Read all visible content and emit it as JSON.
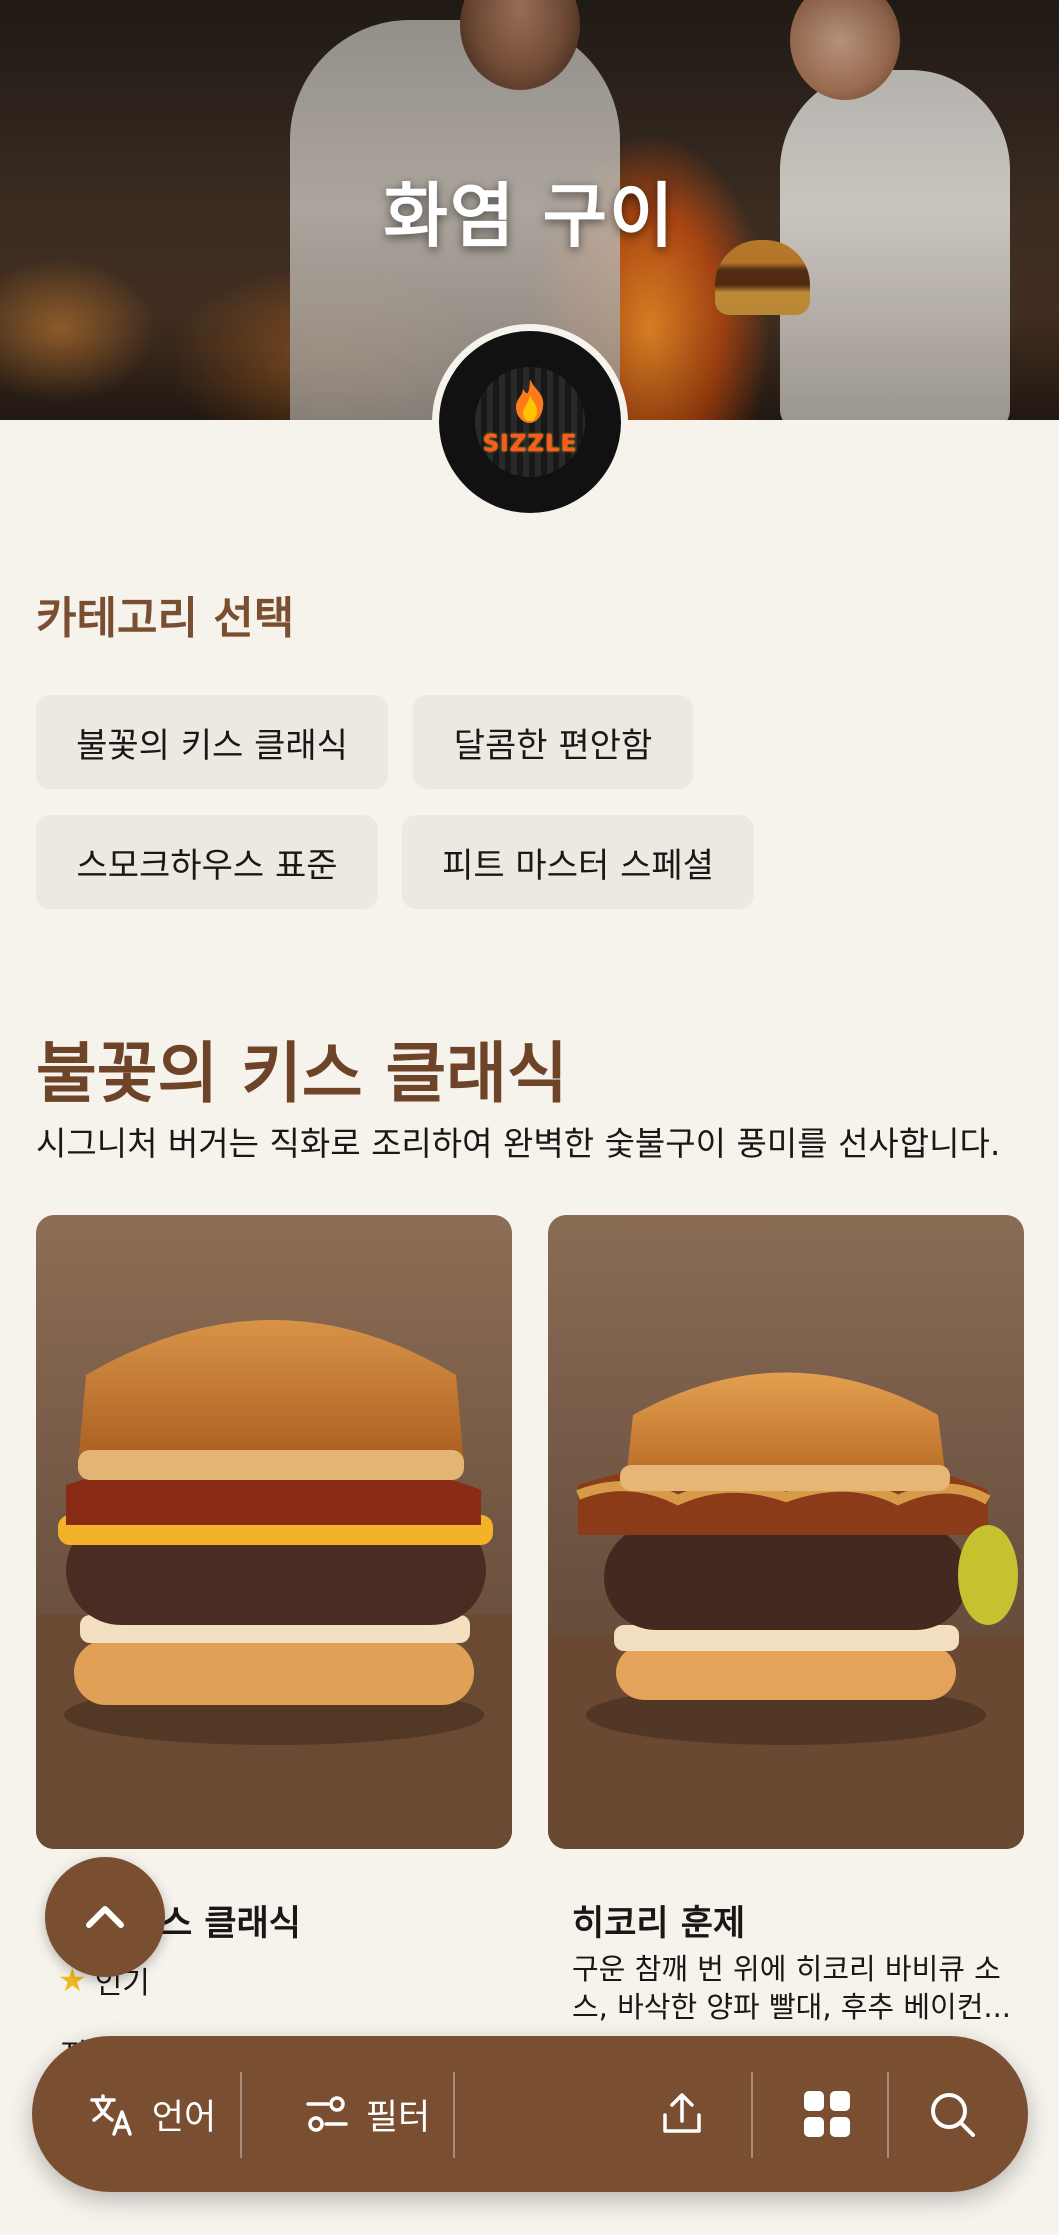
{
  "hero": {
    "title": "화염 구이"
  },
  "logo": {
    "text": "SIZZLE",
    "flame_color": "#ff7a1a",
    "text_color": "#ff5a1f"
  },
  "category_section": {
    "label": "카테고리 선택",
    "chips": [
      "불꽃의 키스 클래식",
      "달콤한 편안함",
      "스모크하우스 표준",
      "피트 마스터 스페셜"
    ]
  },
  "menu_section": {
    "title": "불꽃의 키스 클래식",
    "description": "시그니처 버거는 직화로 조리하여 완벽한 숯불구이 풍미를 선사합니다."
  },
  "cards": [
    {
      "name_visible": "스 클래식",
      "badge": "인기",
      "extra": "저"
    },
    {
      "name": "히코리 훈제",
      "description": "구운 참깨 번 위에 히코리 바비큐 소스, 바삭한 양파 빨대, 후추 베이컨..."
    }
  ],
  "bottom_bar": {
    "language_label": "언어",
    "filter_label": "필터"
  },
  "colors": {
    "brand_brown": "#7a4e30",
    "background": "#f6f2ec",
    "chip_bg": "#ede8e2",
    "star": "#f2b824"
  },
  "icons": [
    "translate-icon",
    "filter-icon",
    "share-icon",
    "grid-icon",
    "search-icon",
    "chevron-up-icon",
    "star-icon"
  ]
}
